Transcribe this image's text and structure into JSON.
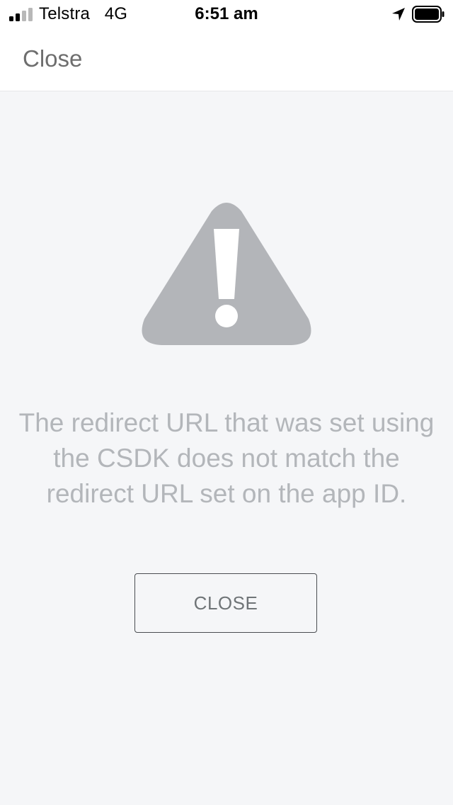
{
  "status_bar": {
    "carrier": "Telstra",
    "network": "4G",
    "time": "6:51 am",
    "signal_bars_filled": 2,
    "signal_bars_total": 4
  },
  "nav": {
    "close_label": "Close"
  },
  "error": {
    "icon": "warning-triangle-icon",
    "icon_color": "#b3b5b9",
    "message": "The redirect URL that was set using the CSDK does not match the redirect URL set on the app ID."
  },
  "actions": {
    "close_button_label": "CLOSE"
  }
}
